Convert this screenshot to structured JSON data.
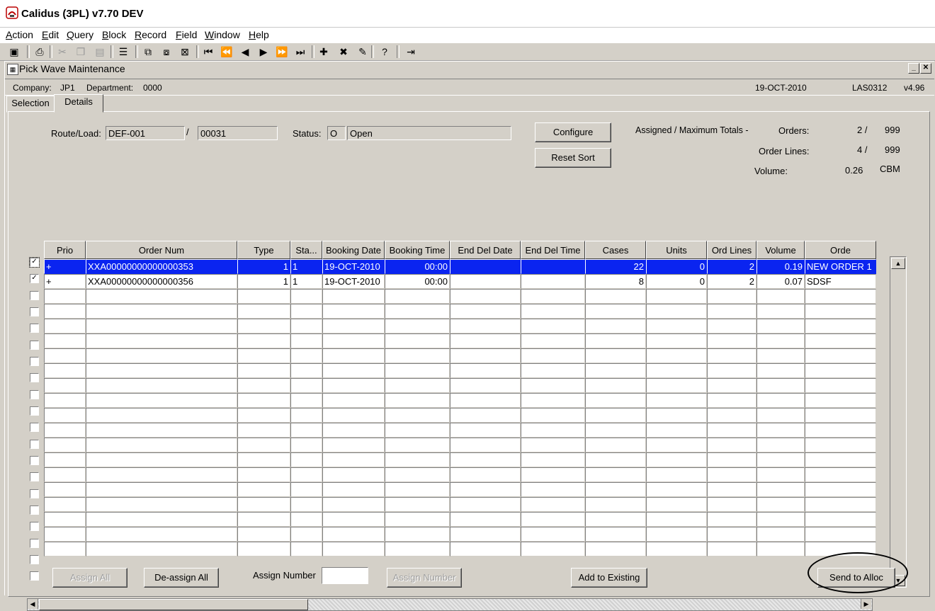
{
  "app": {
    "title": "Calidus (3PL) v7.70 DEV"
  },
  "menu": [
    {
      "key": "action",
      "u": "A",
      "rest": "ction"
    },
    {
      "key": "edit",
      "u": "E",
      "rest": "dit"
    },
    {
      "key": "query",
      "u": "Q",
      "rest": "uery"
    },
    {
      "key": "block",
      "u": "B",
      "rest": "lock"
    },
    {
      "key": "record",
      "u": "R",
      "rest": "ecord"
    },
    {
      "key": "field",
      "u": "F",
      "rest": "ield"
    },
    {
      "key": "window",
      "u": "W",
      "rest": "indow"
    },
    {
      "key": "help",
      "u": "H",
      "rest": "elp"
    }
  ],
  "toolbar": [
    {
      "name": "save-icon",
      "glyph": "▣",
      "enabled": true
    },
    {
      "name": "print-icon",
      "glyph": "⎙",
      "enabled": true
    },
    {
      "name": "cut-icon",
      "glyph": "✂",
      "enabled": false
    },
    {
      "name": "copy-icon",
      "glyph": "❐",
      "enabled": false
    },
    {
      "name": "paste-icon",
      "glyph": "▤",
      "enabled": false
    },
    {
      "name": "list-icon",
      "glyph": "☰",
      "enabled": true
    },
    {
      "name": "enter-query-icon",
      "glyph": "⧉",
      "enabled": true
    },
    {
      "name": "execute-query-icon",
      "glyph": "⧇",
      "enabled": true
    },
    {
      "name": "cancel-query-icon",
      "glyph": "⊠",
      "enabled": true
    },
    {
      "name": "first-record-icon",
      "glyph": "⏮",
      "enabled": true
    },
    {
      "name": "previous-set-icon",
      "glyph": "⏪",
      "enabled": true
    },
    {
      "name": "previous-record-icon",
      "glyph": "◀",
      "enabled": true
    },
    {
      "name": "next-record-icon",
      "glyph": "▶",
      "enabled": true
    },
    {
      "name": "next-set-icon",
      "glyph": "⏩",
      "enabled": true
    },
    {
      "name": "last-record-icon",
      "glyph": "⏭",
      "enabled": true
    },
    {
      "name": "insert-record-icon",
      "glyph": "✚",
      "enabled": true
    },
    {
      "name": "delete-record-icon",
      "glyph": "✖",
      "enabled": true
    },
    {
      "name": "clear-record-icon",
      "glyph": "✎",
      "enabled": true
    },
    {
      "name": "help-icon",
      "glyph": "?",
      "enabled": true
    },
    {
      "name": "exit-icon",
      "glyph": "⇥",
      "enabled": true
    }
  ],
  "window": {
    "title": "Pick Wave Maintenance",
    "company_label": "Company:",
    "company": "JP1",
    "department_label": "Department:",
    "department": "0000",
    "date": "19-OCT-2010",
    "form_code": "LAS0312",
    "version": "v4.96"
  },
  "tabs": [
    {
      "label": "Selection"
    },
    {
      "label": "Details"
    }
  ],
  "header": {
    "route_label": "Route/Load:",
    "route": "DEF-001",
    "separator": "/",
    "load": "00031",
    "status_label": "Status:",
    "status_code": "O",
    "status_text": "Open",
    "configure_label": "Configure",
    "reset_sort_label": "Reset Sort"
  },
  "totals": {
    "title": "Assigned / Maximum Totals -",
    "orders_label": "Orders:",
    "orders_assigned": "2 /",
    "orders_max": "999",
    "lines_label": "Order Lines:",
    "lines_assigned": "4 /",
    "lines_max": "999",
    "volume_label": "Volume:",
    "volume_value": "0.26",
    "volume_unit": "CBM"
  },
  "grid": {
    "columns": [
      "Prio",
      "Order Num",
      "Type",
      "Sta...",
      "Booking Date",
      "Booking Time",
      "End Del Date",
      "End Del Time",
      "Cases",
      "Units",
      "Ord Lines",
      "Volume",
      "Orde"
    ],
    "rows": [
      {
        "checked": true,
        "cells": [
          "+",
          "XXA00000000000000353",
          "1",
          "1",
          "19-OCT-2010",
          "00:00",
          "",
          "",
          "22",
          "0",
          "2",
          "0.19",
          "NEW ORDER 1"
        ]
      },
      {
        "checked": true,
        "cells": [
          "+",
          "XXA00000000000000356",
          "1",
          "1",
          "19-OCT-2010",
          "00:00",
          "",
          "",
          "8",
          "0",
          "2",
          "0.07",
          "SDSF"
        ]
      }
    ],
    "empty_rows": 18
  },
  "footer": {
    "assign_all_label": "Assign All",
    "deassign_all_label": "De-assign All",
    "assign_number_label": "Assign Number",
    "assign_number_value": "",
    "assign_number_button_label": "Assign Number",
    "add_to_existing_label": "Add to Existing",
    "send_to_alloc_label": "Send to Alloc"
  }
}
